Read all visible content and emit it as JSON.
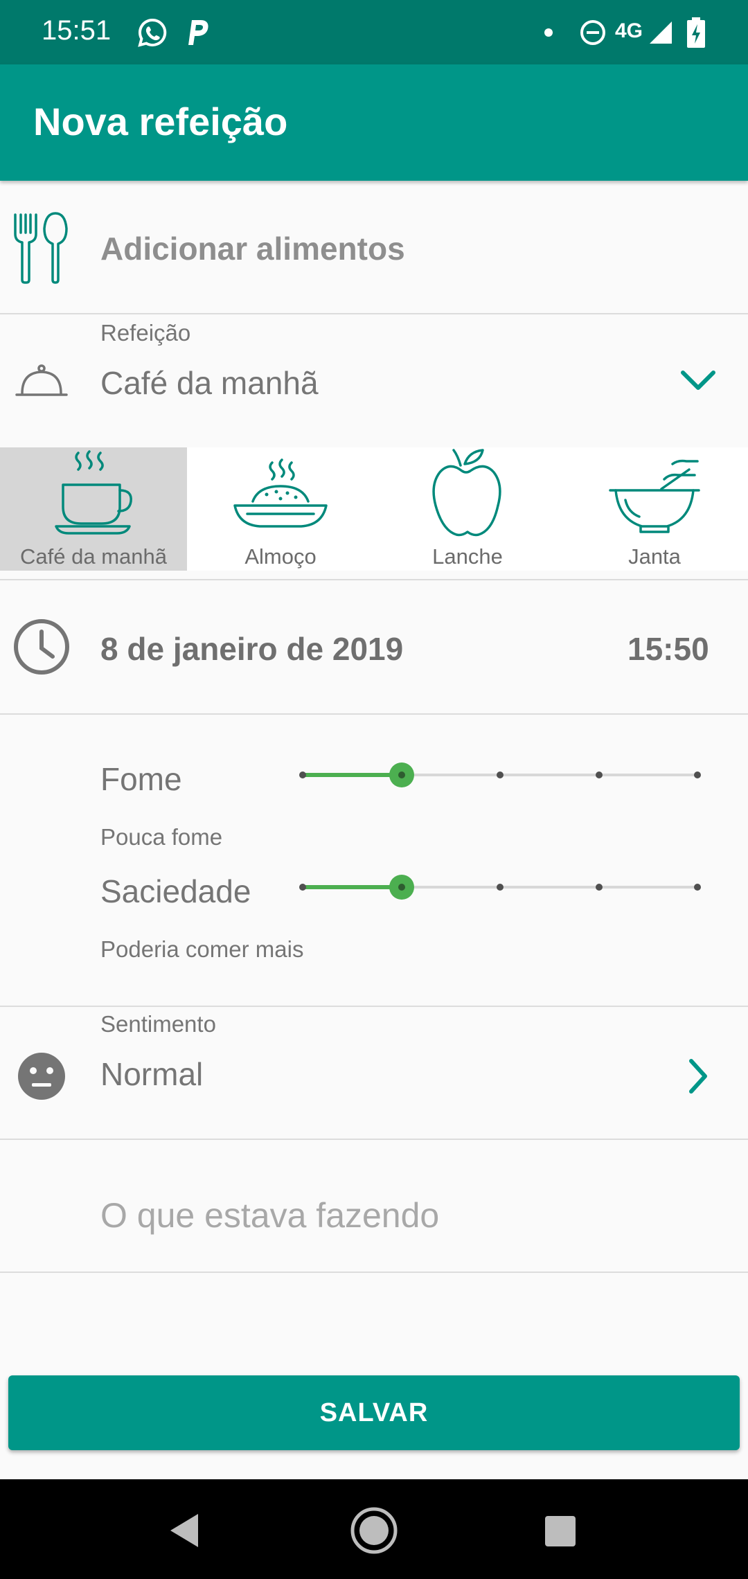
{
  "status_bar": {
    "time": "15:51",
    "network": "4G",
    "icons": [
      "whatsapp-icon",
      "p-app-icon",
      "notification-dot-icon",
      "do-not-disturb-icon",
      "signal-icon",
      "battery-charging-icon"
    ]
  },
  "app_bar": {
    "title": "Nova refeição"
  },
  "add_food": {
    "label": "Adicionar alimentos",
    "icon": "fork-spoon-icon"
  },
  "meal": {
    "caption": "Refeição",
    "value": "Café da manhã",
    "icon": "cloche-icon",
    "options": [
      {
        "label": "Café da manhã",
        "icon": "coffee-cup-icon",
        "selected": true
      },
      {
        "label": "Almoço",
        "icon": "plate-icon",
        "selected": false
      },
      {
        "label": "Lanche",
        "icon": "apple-icon",
        "selected": false
      },
      {
        "label": "Janta",
        "icon": "bowl-icon",
        "selected": false
      }
    ]
  },
  "datetime": {
    "date": "8 de janeiro de 2019",
    "time": "15:50",
    "icon": "clock-icon"
  },
  "hunger": {
    "title": "Fome",
    "subtitle": "Pouca fome",
    "level": 2,
    "steps": 5
  },
  "satiety": {
    "title": "Saciedade",
    "subtitle": "Poderia comer mais",
    "level": 2,
    "steps": 5
  },
  "feeling": {
    "caption": "Sentimento",
    "value": "Normal",
    "icon": "neutral-face-icon"
  },
  "activity": {
    "placeholder": "O que estava fazendo",
    "value": ""
  },
  "save_label": "SALVAR",
  "colors": {
    "primary": "#009688",
    "primary_dark": "#00796b",
    "slider": "#4caf50"
  }
}
